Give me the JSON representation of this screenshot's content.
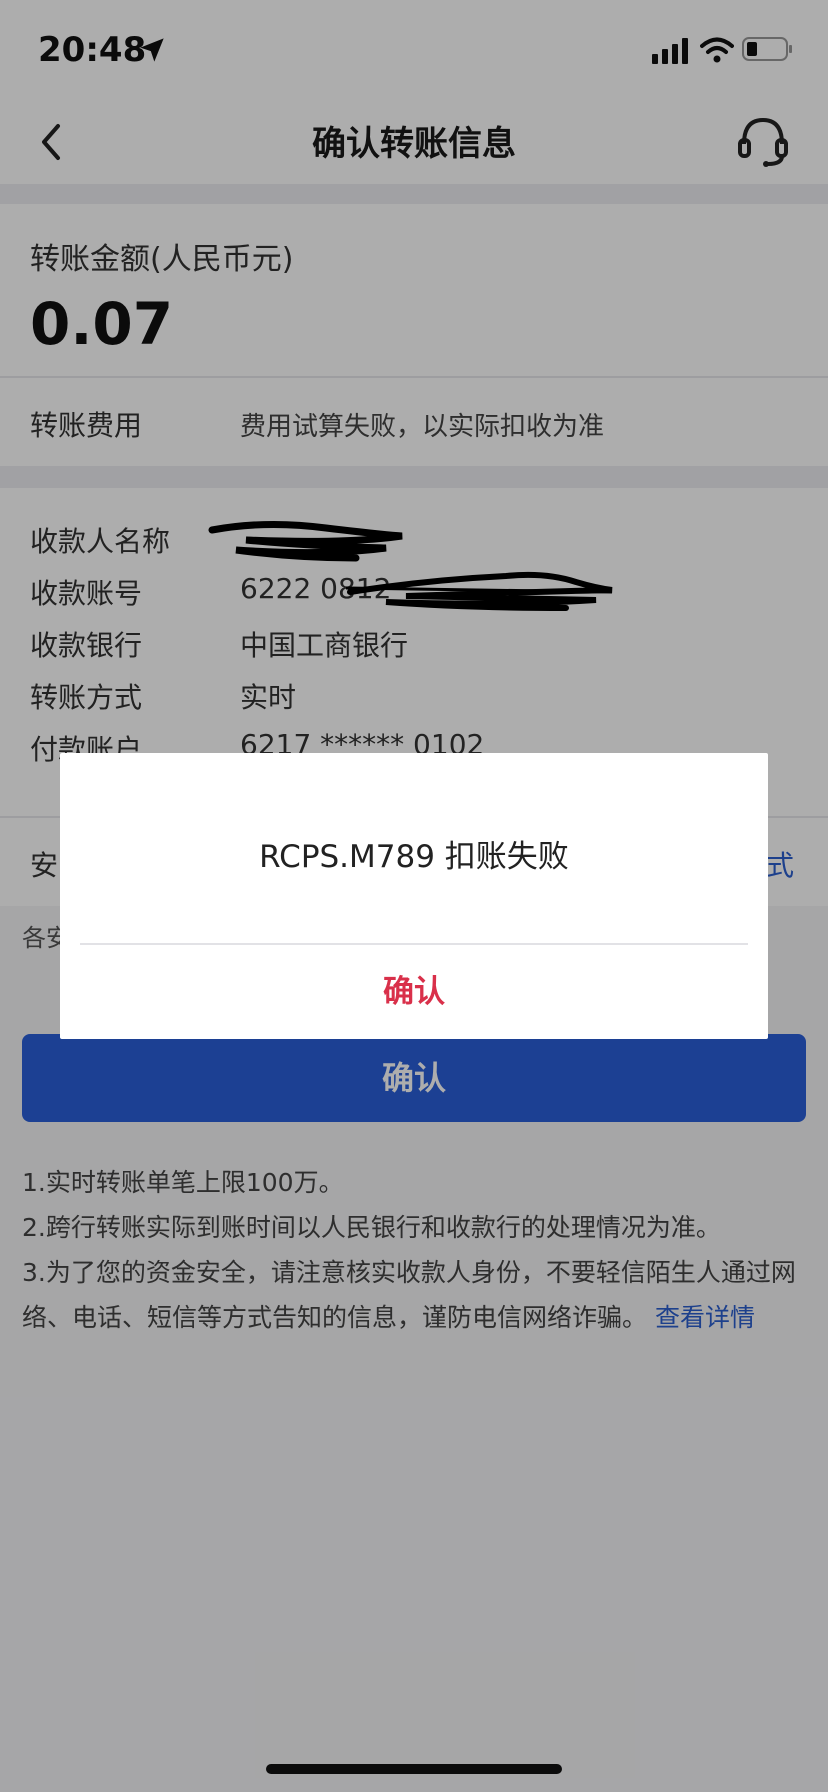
{
  "status_bar": {
    "time": "20:48"
  },
  "nav": {
    "title": "确认转账信息"
  },
  "amount": {
    "label": "转账金额(人民币元)",
    "value": "0.07"
  },
  "fee": {
    "label": "转账费用",
    "value": "费用试算失败，以实际扣收为准"
  },
  "details": [
    {
      "label": "收款人名称",
      "value": ""
    },
    {
      "label": "收款账号",
      "value": "6222 0812"
    },
    {
      "label": "收款银行",
      "value": "中国工商银行"
    },
    {
      "label": "转账方式",
      "value": "实时"
    },
    {
      "label": "付款账户",
      "value": "6217 ****** 0102"
    }
  ],
  "security": {
    "label": "安",
    "link": "式"
  },
  "security_note": "各安",
  "confirm_button": "确认",
  "notes": {
    "line1": "1.实时转账单笔上限100万。",
    "line2": "2.跨行转账实际到账时间以人民银行和收款行的处理情况为准。",
    "line3": "3.为了您的资金安全，请注意核实收款人身份，不要轻信陌生人通过网络、电话、短信等方式告知的信息，谨防电信网络诈骗。",
    "link": "查看详情"
  },
  "dialog": {
    "message": "RCPS.M789 扣账失败",
    "confirm": "确认"
  },
  "colors": {
    "primary": "#2a5fd9",
    "danger": "#d9304a",
    "link": "#2b5fcf"
  }
}
